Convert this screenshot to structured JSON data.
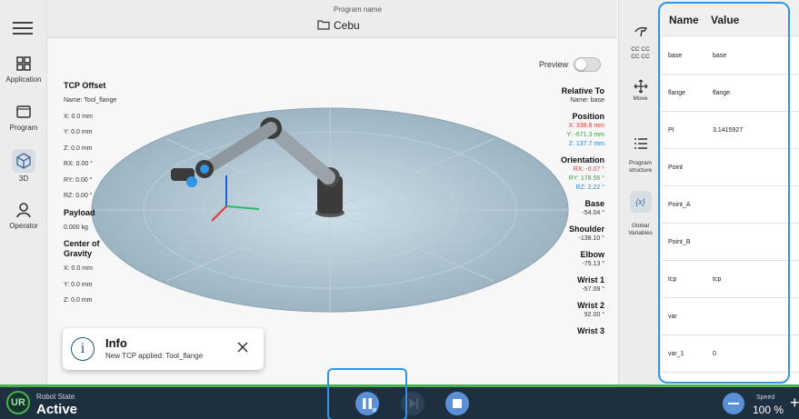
{
  "program": {
    "caption": "Program name",
    "name": "Cebu"
  },
  "nav": [
    {
      "label": "Application",
      "icon": "grid-icon"
    },
    {
      "label": "Program",
      "icon": "program-icon"
    },
    {
      "label": "3D",
      "icon": "cube-icon"
    },
    {
      "label": "Operator",
      "icon": "person-icon"
    }
  ],
  "preview": {
    "label": "Preview",
    "on": false
  },
  "tcp": {
    "offset_title": "TCP Offset",
    "offset_name": "Name: Tool_flange",
    "x": "X: 0.0 mm",
    "y": "Y: 0.0 mm",
    "z": "Z: 0.0 mm",
    "rx": "RX: 0.00 °",
    "ry": "RY: 0.00 °",
    "rz": "RZ: 0.00 °",
    "payload_title": "Payload",
    "payload_value": "0.000 kg",
    "cog_title_1": "Center of",
    "cog_title_2": "Gravity",
    "cog_x": "X: 0.0 mm",
    "cog_y": "Y: 0.0 mm",
    "cog_z": "Z: 0.0 mm"
  },
  "readout": {
    "relative_title": "Relative To",
    "relative_name": "Name: base",
    "position_title": "Position",
    "pos_x": "X: 336.6 mm",
    "pos_y": "Y: -671.3 mm",
    "pos_z": "Z: 137.7 mm",
    "orientation_title": "Orientation",
    "rx": "RX: -0.07 °",
    "ry": "RY: 178.56 °",
    "rz": "RZ: 2.22 °",
    "base_title": "Base",
    "base_value": "-54.04 °",
    "shoulder_title": "Shoulder",
    "shoulder_value": "-138.10 °",
    "elbow_title": "Elbow",
    "elbow_value": "-75.13 °",
    "wrist1_title": "Wrist 1",
    "wrist1_value": "-57.09 °",
    "wrist2_title": "Wrist 2",
    "wrist2_value": "92.00 °",
    "wrist3_title": "Wrist 3"
  },
  "toast": {
    "title": "Info",
    "message": "New TCP applied: Tool_flange"
  },
  "tools": [
    {
      "label": "",
      "icon": "hand-icon"
    },
    {
      "label": "CC CC\nCC CC",
      "icon": ""
    },
    {
      "label": "Move",
      "icon": "move-icon"
    },
    {
      "label": "Program\nstructure",
      "icon": "list-icon"
    },
    {
      "label": "Global\nVariables",
      "icon": "variables-icon",
      "glyph": "{x}"
    }
  ],
  "variables": {
    "header_name": "Name",
    "header_value": "Value",
    "rows": [
      {
        "name": "base",
        "value": "base"
      },
      {
        "name": "flange",
        "value": "flange"
      },
      {
        "name": "PI",
        "value": "3.1415927"
      },
      {
        "name": "Point",
        "value": ""
      },
      {
        "name": "Point_A",
        "value": ""
      },
      {
        "name": "Point_B",
        "value": ""
      },
      {
        "name": "tcp",
        "value": "tcp"
      },
      {
        "name": "var",
        "value": ""
      },
      {
        "name": "var_1",
        "value": "0"
      }
    ]
  },
  "status": {
    "logo": "UR",
    "robot_state_label": "Robot State",
    "robot_state_value": "Active",
    "speed_label": "Speed",
    "speed_value": "100 %"
  },
  "colors": {
    "accent": "#2f95e6",
    "bottom_bar": "#1e2f3f",
    "active_green": "#4caf50",
    "control_blue": "#5b8fd6"
  }
}
